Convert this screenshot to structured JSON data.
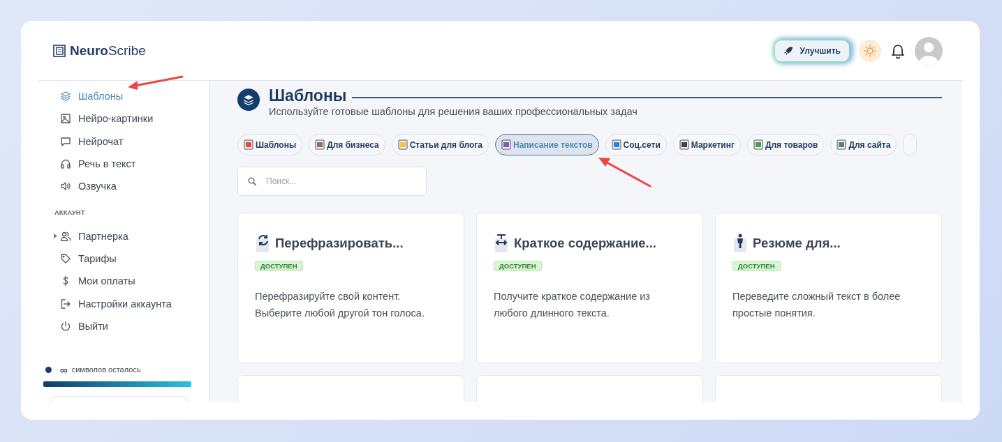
{
  "brand": {
    "bold": "Neuro",
    "light": "Scribe"
  },
  "header": {
    "upgrade_button": "Улучшить"
  },
  "sidebar": {
    "items": [
      {
        "label": "Шаблоны",
        "selected": true
      },
      {
        "label": "Нейро-картинки",
        "selected": false
      },
      {
        "label": "Нейрочат",
        "selected": false
      },
      {
        "label": "Речь в текст",
        "selected": false
      },
      {
        "label": "Озвучка",
        "selected": false
      }
    ],
    "section_label": "АККАУНТ",
    "account_items": [
      {
        "label": "Партнерка",
        "expanded": false,
        "selected": false
      },
      {
        "label": "Тарифы",
        "selected": false
      },
      {
        "label": "Мои оплаты",
        "selected": false
      },
      {
        "label": "Настройки аккаунта",
        "selected": false
      },
      {
        "label": "Выйти",
        "selected": false
      }
    ],
    "quota": {
      "amount": "∞",
      "label": "символов осталось",
      "level": 1
    }
  },
  "page": {
    "title": "Шаблоны",
    "subtitle": "Используйте готовые шаблоны для решения ваших профессиональных задач"
  },
  "chips": [
    {
      "label": "Шаблоны",
      "selected": false
    },
    {
      "label": "Для бизнеса",
      "selected": false
    },
    {
      "label": "Статьи для блога",
      "selected": false
    },
    {
      "label": "Написание текстов",
      "selected": true
    },
    {
      "label": "Соц.сети",
      "selected": false
    },
    {
      "label": "Маркетинг",
      "selected": false
    },
    {
      "label": "Для товаров",
      "selected": false
    },
    {
      "label": "Для сайта",
      "selected": false
    }
  ],
  "search": {
    "placeholder": "Поиск..."
  },
  "cards": [
    {
      "title": "Перефразировать...",
      "badge": "ДОСТУПЕН",
      "description": "Перефразируйте свой контент. Выберите любой другой тон голоса."
    },
    {
      "title": "Краткое содержание...",
      "badge": "ДОСТУПЕН",
      "description": "Получите краткое содержание из любого длинного текста."
    },
    {
      "title": "Резюме для...",
      "badge": "ДОСТУПЕН",
      "description": "Переведите сложный текст в более простые понятия."
    }
  ]
}
